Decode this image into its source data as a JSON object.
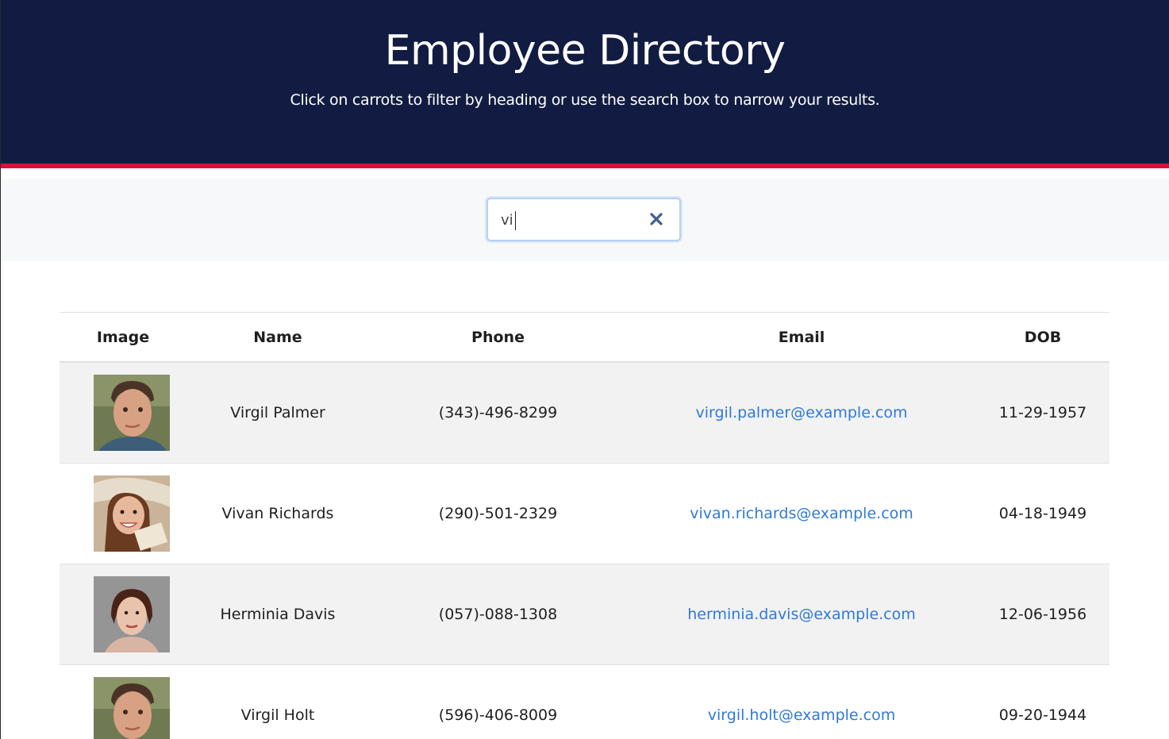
{
  "header": {
    "title": "Employee Directory",
    "subtitle": "Click on carrots to filter by heading or use the search box to narrow your results."
  },
  "search": {
    "value": "vi",
    "clear_icon": "close-icon"
  },
  "table": {
    "columns": [
      "Image",
      "Name",
      "Phone",
      "Email",
      "DOB"
    ],
    "rows": [
      {
        "avatar_icon": "avatar-man-icon",
        "name": "Virgil Palmer",
        "phone": "(343)-496-8299",
        "email": "virgil.palmer@example.com",
        "dob": "11-29-1957"
      },
      {
        "avatar_icon": "avatar-woman-icon",
        "name": "Vivan Richards",
        "phone": "(290)-501-2329",
        "email": "vivan.richards@example.com",
        "dob": "04-18-1949"
      },
      {
        "avatar_icon": "avatar-woman-icon",
        "name": "Herminia Davis",
        "phone": "(057)-088-1308",
        "email": "herminia.davis@example.com",
        "dob": "12-06-1956"
      },
      {
        "avatar_icon": "avatar-man-icon",
        "name": "Virgil Holt",
        "phone": "(596)-406-8009",
        "email": "virgil.holt@example.com",
        "dob": "09-20-1944"
      }
    ]
  },
  "colors": {
    "header_bg": "#121c42",
    "accent": "#d90f3c",
    "link": "#2f79d8",
    "stripe": "#f2f2f2"
  }
}
